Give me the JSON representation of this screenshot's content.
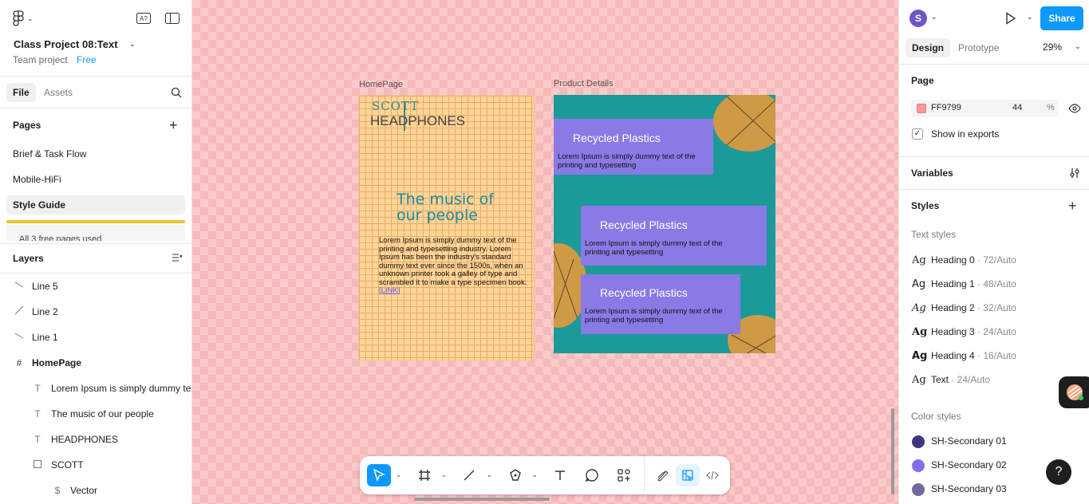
{
  "app": {
    "project_title": "Class Project 08:Text",
    "team": "Team project",
    "plan": "Free"
  },
  "left_tabs": [
    "File",
    "Assets"
  ],
  "pages": {
    "heading": "Pages",
    "items": [
      "Brief & Task Flow",
      "Mobile-HiFi",
      "Style Guide"
    ],
    "selected": "Style Guide",
    "free_note": "All 3 free pages used"
  },
  "layers": {
    "heading": "Layers",
    "items": [
      {
        "icon": "line-icon",
        "label": "Line 5"
      },
      {
        "icon": "line-icon",
        "label": "Line 2"
      },
      {
        "icon": "line-icon",
        "label": "Line 1"
      },
      {
        "icon": "frame-icon",
        "label": "HomePage"
      },
      {
        "icon": "text-icon",
        "label": "Lorem Ipsum is simply dummy text"
      },
      {
        "icon": "text-icon",
        "label": "The music of our people"
      },
      {
        "icon": "text-icon",
        "label": "HEADPHONES"
      },
      {
        "icon": "rectangle-icon",
        "label": "SCOTT"
      },
      {
        "icon": "vector-icon",
        "label": "Vector"
      }
    ]
  },
  "canvas": {
    "background": "#FF9799",
    "home_frame": {
      "label": "HomePage",
      "logo_top": "SCOTT",
      "logo_bottom": "HEADPHONES",
      "headline": "The music of our people",
      "body": "Lorem Ipsum is simply dummy text of the printing and typesetting industry. Lorem Ipsum has been the industry's standard dummy text ever since the 1500s, when an unknown printer took a galley of type and scrambled it to make a type specimen book.",
      "link": "[LINK]"
    },
    "product_frame": {
      "label": "Product Details",
      "cards": [
        {
          "title": "Recycled Plastics",
          "body": "Lorem Ipsum is simply dummy text of the printing and typesetting"
        },
        {
          "title": "Recycled Plastics",
          "body": "Lorem Ipsum is simply dummy text of the printing and typesetting"
        },
        {
          "title": "Recycled Plastics",
          "body": "Lorem Ipsum is simply dummy text of the printing and typesetting"
        }
      ]
    }
  },
  "toolbar": {
    "tools": [
      "move-tool",
      "frame-tool",
      "line-tool",
      "pen-tool",
      "text-tool",
      "comment-tool",
      "actions-tool",
      "draw-mode",
      "design-mode",
      "dev-mode"
    ]
  },
  "right": {
    "avatar_letter": "S",
    "share_label": "Share",
    "tabs": [
      "Design",
      "Prototype"
    ],
    "zoom": "29%",
    "page_heading": "Page",
    "page_color_hex": "FF9799",
    "page_opacity": "44",
    "percent": "%",
    "show_in_exports": "Show in exports",
    "variables_heading": "Variables",
    "styles_heading": "Styles",
    "text_styles_heading": "Text styles",
    "text_styles": [
      {
        "glyph": "Ag",
        "name": "Heading 0",
        "meta": " · 72/Auto"
      },
      {
        "glyph": "Ag",
        "name": "Heading 1",
        "meta": " · 48/Auto"
      },
      {
        "glyph": "Ag",
        "name": "Heading 2",
        "meta": " · 32/Auto"
      },
      {
        "glyph": "Ag",
        "name": "Heading 3",
        "meta": " · 24/Auto"
      },
      {
        "glyph": "Ag",
        "name": "Heading 4",
        "meta": " · 16/Auto"
      },
      {
        "glyph": "Ag",
        "name": "Text",
        "meta": " · 24/Auto"
      }
    ],
    "color_styles_heading": "Color styles",
    "color_styles": [
      {
        "name": "SH-Secondary 01",
        "color": "#3d3680"
      },
      {
        "name": "SH-Secondary 02",
        "color": "#8370e8"
      },
      {
        "name": "SH-Secondary 03",
        "color": "#6f6a9a"
      }
    ],
    "help_label": "?"
  }
}
